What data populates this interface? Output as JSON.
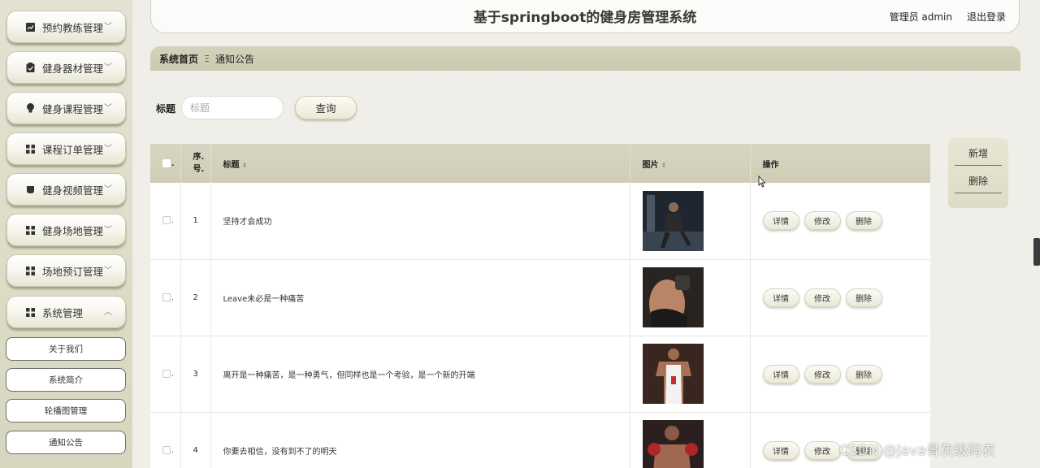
{
  "app": {
    "title": "基于springboot的健身房管理系统",
    "user_label": "管理员 admin",
    "logout_label": "退出登录"
  },
  "sidebar": {
    "items": [
      {
        "label": "预约教练管理",
        "icon": "chart-icon"
      },
      {
        "label": "健身器材管理",
        "icon": "clipboard-icon"
      },
      {
        "label": "健身课程管理",
        "icon": "lightbulb-icon"
      },
      {
        "label": "课程订单管理",
        "icon": "grid-icon"
      },
      {
        "label": "健身视频管理",
        "icon": "cup-icon"
      },
      {
        "label": "健身场地管理",
        "icon": "grid-icon"
      },
      {
        "label": "场地预订管理",
        "icon": "grid-icon"
      },
      {
        "label": "系统管理",
        "icon": "grid-icon"
      }
    ],
    "submenu": [
      {
        "label": "关于我们"
      },
      {
        "label": "系统简介"
      },
      {
        "label": "轮播图管理"
      },
      {
        "label": "通知公告"
      }
    ]
  },
  "breadcrumb": {
    "home": "系统首页",
    "separator": "Ξ",
    "current": "通知公告"
  },
  "search": {
    "label": "标题",
    "placeholder": "标题",
    "value": "",
    "button_label": "查询"
  },
  "actions": {
    "add_label": "新增",
    "delete_label": "删除"
  },
  "table": {
    "headers": {
      "index_line1": "序.",
      "index_line2": "号.",
      "title": "标题",
      "image": "图片",
      "ops": "操作"
    },
    "op_labels": {
      "detail": "详情",
      "edit": "修改",
      "delete": "删除"
    },
    "rows": [
      {
        "index": "1",
        "title": "坚持才会成功",
        "image": "gym-photo-1"
      },
      {
        "index": "2",
        "title": "Leave未必是一种痛苦",
        "image": "gym-photo-2"
      },
      {
        "index": "3",
        "title": "离开是一种痛苦，是一种勇气，但同样也是一个考验，是一个新的开端",
        "image": "gym-photo-3"
      },
      {
        "index": "4",
        "title": "你要去相信，没有到不了的明天",
        "image": "gym-photo-4"
      }
    ]
  },
  "watermark": "CSDN @Java骨灰级码农",
  "colors": {
    "sidebar_bg": "#dddcc7",
    "header_bar": "#cfcdb6",
    "page_bg": "#efeee9"
  }
}
